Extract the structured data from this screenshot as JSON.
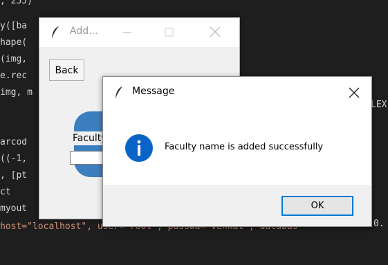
{
  "editor": {
    "lines": [
      ", 255)",
      "y([ba",
      "hape(",
      "(img,",
      "e.rec",
      "img, m",
      "",
      "arcod",
      "((-1,",
      ", [pt",
      "ct",
      "myout",
      "host=\"localhost\", user=\"root\", passwd=\"venkat\", databas"
    ],
    "right_fragments": {
      "lex": "LEX",
      "zero": "0."
    }
  },
  "add_window": {
    "title": "Add...",
    "back_label": "Back",
    "faculty_label": "Faculty",
    "icon": "feather-icon"
  },
  "message_dialog": {
    "title": "Message",
    "text": "Faculty name is added successfully",
    "ok_label": "OK",
    "icon": "info-icon",
    "colors": {
      "info": "#0a64c8",
      "ok_border": "#0078d7"
    }
  }
}
